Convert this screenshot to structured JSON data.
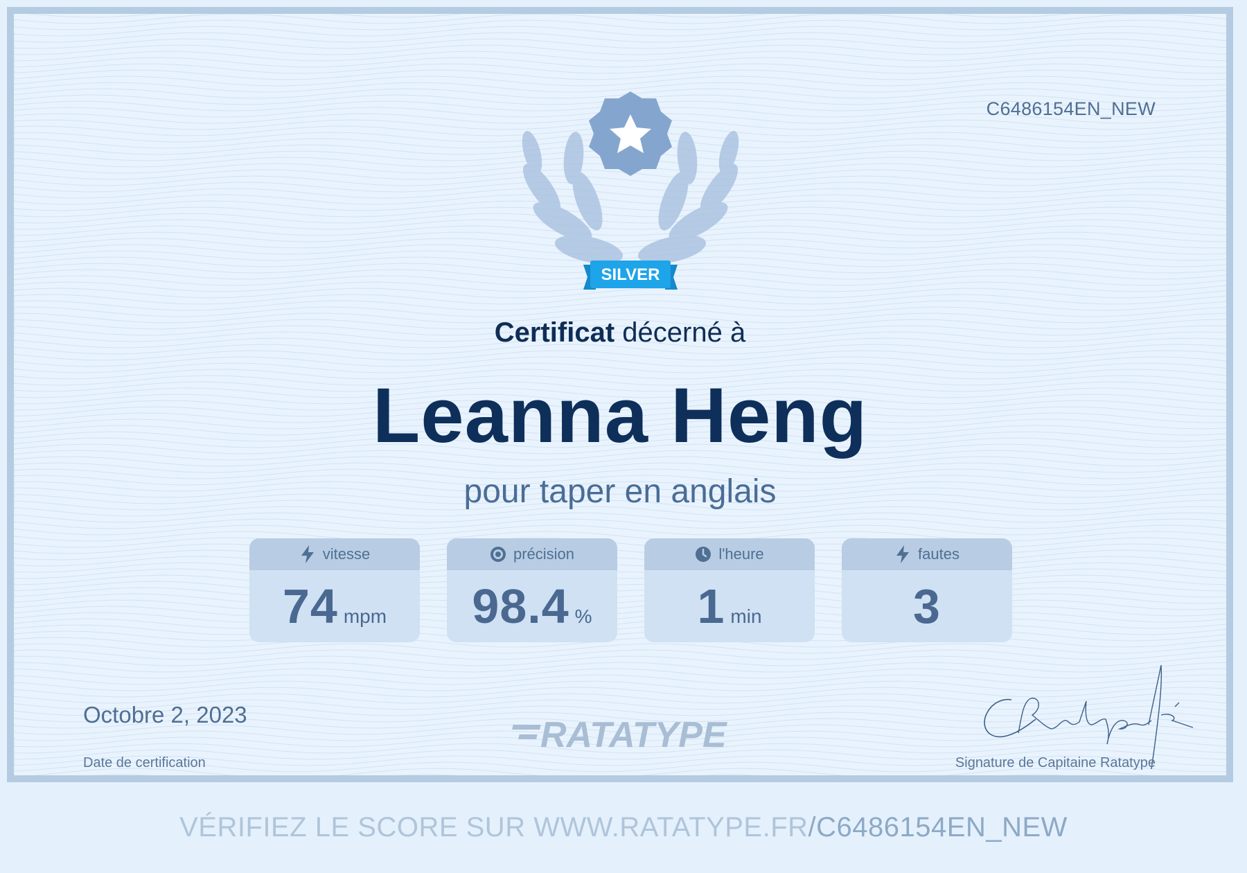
{
  "certificate_id": "C6486154EN_NEW",
  "badge": {
    "label": "SILVER"
  },
  "heading": {
    "bold": "Certificat",
    "rest": "décerné à"
  },
  "recipient_name": "Leanna Heng",
  "subtitle": "pour taper en anglais",
  "stats": [
    {
      "label": "vitesse",
      "icon": "lightning-icon",
      "value": "74",
      "unit": "mpm"
    },
    {
      "label": "précision",
      "icon": "target-icon",
      "value": "98.4",
      "unit": "%"
    },
    {
      "label": "l'heure",
      "icon": "clock-icon",
      "value": "1",
      "unit": "min"
    },
    {
      "label": "fautes",
      "icon": "lightning-icon",
      "value": "3",
      "unit": ""
    }
  ],
  "date": {
    "value": "Octobre 2, 2023",
    "label": "Date de certification"
  },
  "logo_text": "RATATYPE",
  "signature": {
    "text": "CRatatype-fé",
    "label": "Signature de Capitaine Ratatype"
  },
  "verify": {
    "prefix": "VÉRIFIEZ LE SCORE SUR WWW.RATATYPE.FR",
    "code": "/C6486154EN_NEW"
  },
  "colors": {
    "navy": "#0e2f5a",
    "frame": "#b5cbe2",
    "badge": "#1ea4e9",
    "laurel": "#a7bfdd",
    "seal": "#84a6ce"
  }
}
